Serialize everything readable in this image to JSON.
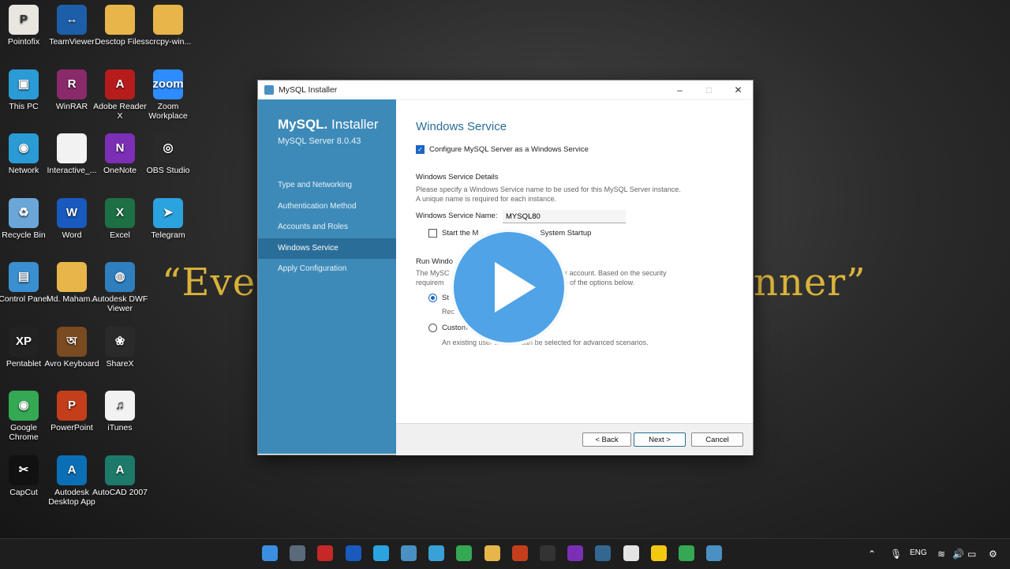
{
  "wallpaper": {
    "quote_left": "“Even",
    "quote_right": "nner”"
  },
  "desktop_icons": [
    {
      "label": "Pointofix",
      "color": "#e9e6df",
      "glyph": "P"
    },
    {
      "label": "TeamViewer",
      "color": "#1d5ea8",
      "glyph": "↔"
    },
    {
      "label": "Desctop Files",
      "color": "#e8b54a",
      "glyph": ""
    },
    {
      "label": "scrcpy-win...",
      "color": "#e8b54a",
      "glyph": ""
    },
    {
      "label": "This PC",
      "color": "#2b9bd6",
      "glyph": "▣"
    },
    {
      "label": "WinRAR",
      "color": "#8a2a6a",
      "glyph": "R"
    },
    {
      "label": "Adobe Reader X",
      "color": "#b71c1c",
      "glyph": "A"
    },
    {
      "label": "Zoom Workplace",
      "color": "#2d8cff",
      "glyph": "zoom"
    },
    {
      "label": "Network",
      "color": "#2b9bd6",
      "glyph": "◉"
    },
    {
      "label": "Interactive_...",
      "color": "#f2f2f2",
      "glyph": ""
    },
    {
      "label": "OneNote",
      "color": "#7b2fb5",
      "glyph": "N"
    },
    {
      "label": "OBS Studio",
      "color": "#2a2a2a",
      "glyph": "◎"
    },
    {
      "label": "Recycle Bin",
      "color": "#6aa7d8",
      "glyph": "♻"
    },
    {
      "label": "Word",
      "color": "#185abd",
      "glyph": "W"
    },
    {
      "label": "Excel",
      "color": "#1d7044",
      "glyph": "X"
    },
    {
      "label": "Telegram",
      "color": "#2aa3df",
      "glyph": "➤"
    },
    {
      "label": "Control Panel",
      "color": "#3a8fd0",
      "glyph": "▤"
    },
    {
      "label": "Md. Maham...",
      "color": "#e8b54a",
      "glyph": ""
    },
    {
      "label": "Autodesk DWF Viewer",
      "color": "#2f7fbf",
      "glyph": "◍"
    },
    {
      "label": "Pentablet",
      "color": "#222222",
      "glyph": "XP"
    },
    {
      "label": "Avro Keyboard",
      "color": "#7a4a20",
      "glyph": "অ"
    },
    {
      "label": "ShareX",
      "color": "#2a2a2a",
      "glyph": "❀"
    },
    {
      "label": "Google Chrome",
      "color": "#34a853",
      "glyph": "◉"
    },
    {
      "label": "PowerPoint",
      "color": "#c43e1c",
      "glyph": "P"
    },
    {
      "label": "iTunes",
      "color": "#f2f2f2",
      "glyph": "♫"
    },
    {
      "label": "CapCut",
      "color": "#111111",
      "glyph": "✂"
    },
    {
      "label": "Autodesk Desktop App",
      "color": "#0b6fb6",
      "glyph": "A"
    },
    {
      "label": "AutoCAD 2007",
      "color": "#1d7a6a",
      "glyph": "A"
    }
  ],
  "window": {
    "title": "MySQL Installer",
    "minimize": "–",
    "maximize": "□",
    "close": "✕"
  },
  "sidebar": {
    "brand_mysql": "MySQL.",
    "brand_installer": "Installer",
    "server_version": "MySQL Server 8.0.43",
    "steps": [
      "Type and Networking",
      "Authentication Method",
      "Accounts and Roles",
      "Windows Service",
      "Apply Configuration"
    ],
    "active_step": "Windows Service"
  },
  "main": {
    "heading": "Windows Service",
    "configure_checkbox": "Configure MySQL Server as a Windows Service",
    "details_heading": "Windows Service Details",
    "details_desc_1": "Please specify a Windows Service name to be used for this MySQL Server instance.",
    "details_desc_2": "A unique name is required for each instance.",
    "service_name_label": "Windows Service Name:",
    "service_name_value": "MYSQL80",
    "startup_checkbox_start": "Start the M",
    "startup_checkbox_end": "System Startup",
    "run_heading": "Run Windo",
    "run_desc_1a": "The MySC",
    "run_desc_1b": "n user account. Based on the security",
    "run_desc_2a": "requirem",
    "run_desc_2b": "ck one of the options below.",
    "option_standard": "St",
    "option_standard_desc": "Rec",
    "option_standard_desc_end": ".",
    "option_custom": "Custom",
    "option_custom_desc": "An existing user account can be selected for advanced scenarios."
  },
  "footer": {
    "back": "< Back",
    "next": "Next >",
    "cancel": "Cancel"
  },
  "taskbar": {
    "language": "ENG",
    "apps": [
      "start",
      "camera",
      "mysql",
      "word",
      "telegram",
      "notepad",
      "photos",
      "chrome",
      "file-explorer",
      "powerpoint",
      "obs",
      "onenote",
      "postgres",
      "paint",
      "power-bi",
      "chrome-alt",
      "mysql-installer"
    ]
  }
}
